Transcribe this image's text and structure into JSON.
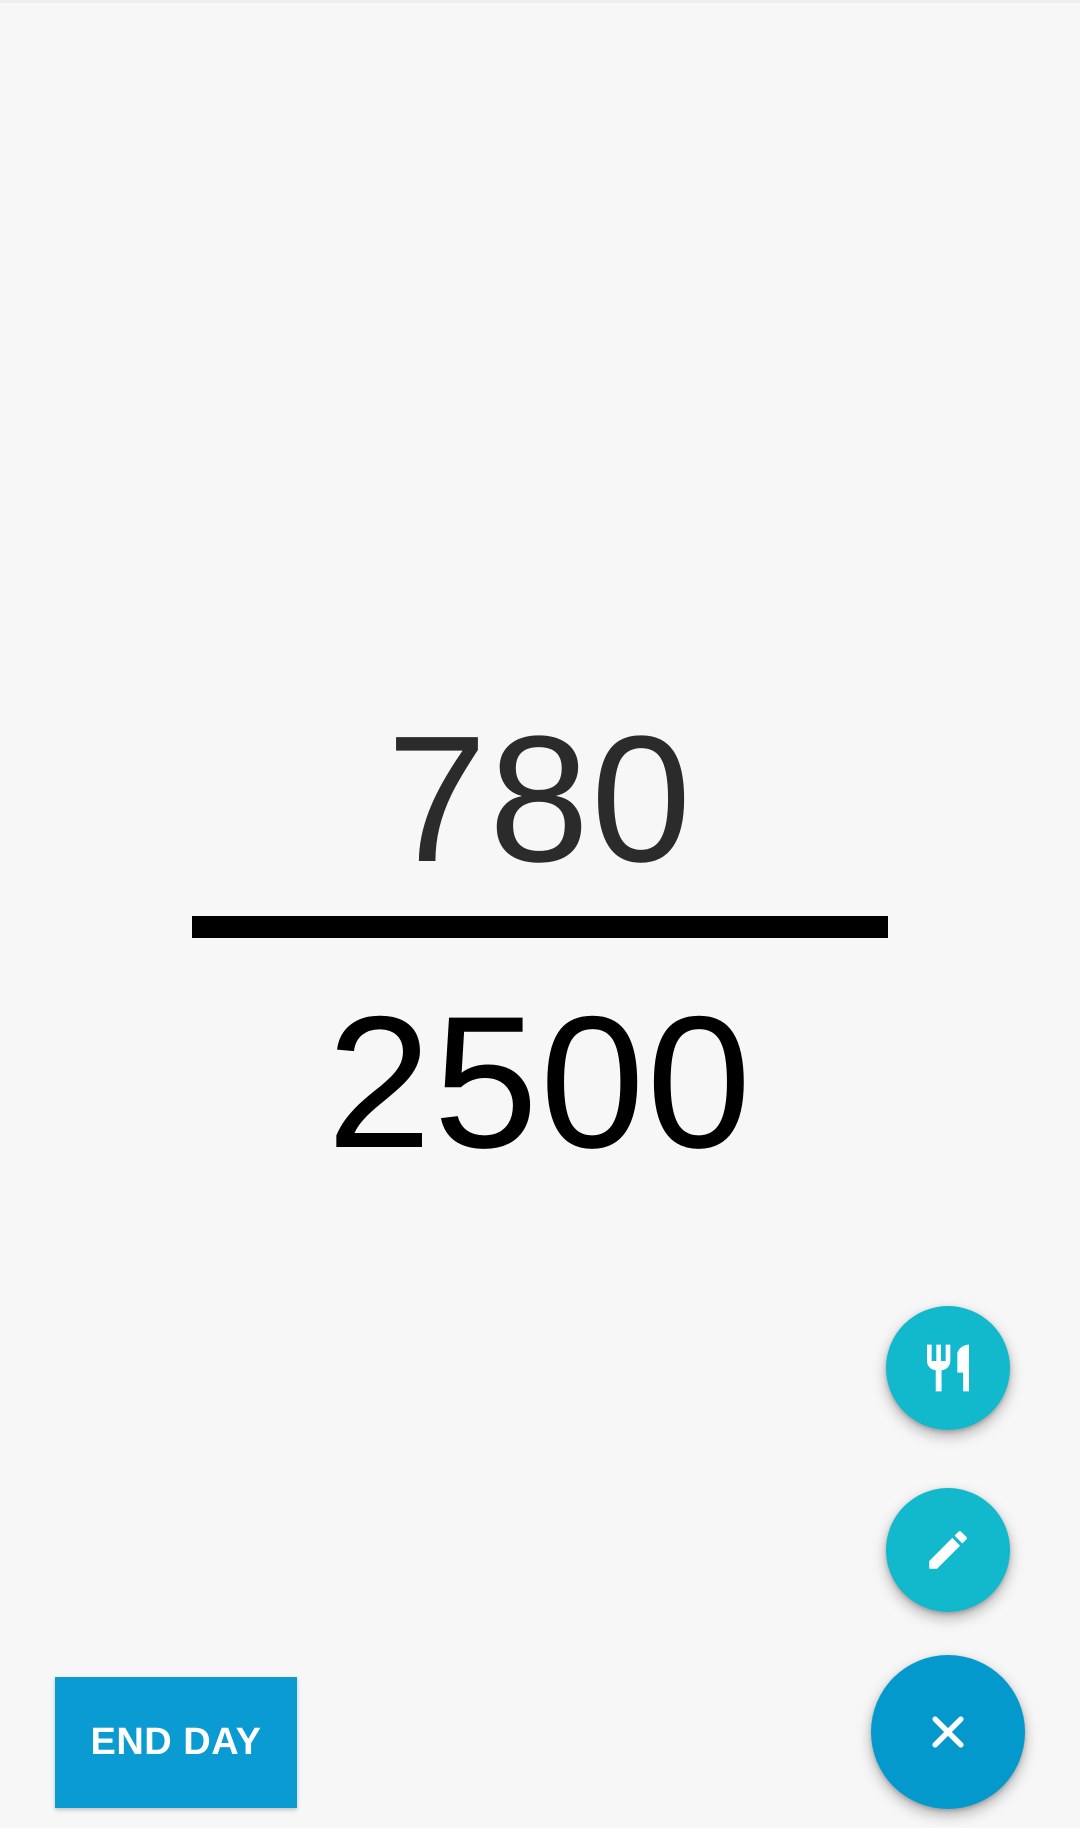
{
  "calories": {
    "consumed": "780",
    "goal": "2500"
  },
  "actions": {
    "end_day_label": "END DAY",
    "meal_icon": "restaurant-icon",
    "edit_icon": "pencil-icon",
    "close_icon": "close-icon"
  },
  "colors": {
    "background": "#f7f7f7",
    "mini_fab": "#12b8cb",
    "main_fab": "#0399cc",
    "end_day_button": "#0a9bd2"
  }
}
